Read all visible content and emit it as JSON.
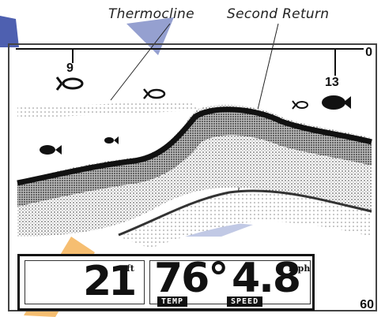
{
  "annotations": {
    "thermocline": "Thermocline",
    "second_return": "Second Return"
  },
  "depth_scale": {
    "top": "0",
    "bottom": "60"
  },
  "fish_ids": {
    "fish_1_depth": "9",
    "fish_2_depth": "13"
  },
  "readouts": {
    "depth_value": "21",
    "depth_unit": "ft",
    "temp_value": "76°",
    "temp_label": "TEMP",
    "speed_value": "4.8",
    "speed_unit": "mph",
    "speed_label": "SPEED"
  },
  "colors": {
    "ink": "#111111",
    "watermark_blue": "#3a4fa8",
    "watermark_orange": "#f2a53a"
  },
  "icons": {
    "fish": "fish-icon",
    "fish_outline": "fish-outline-icon"
  }
}
